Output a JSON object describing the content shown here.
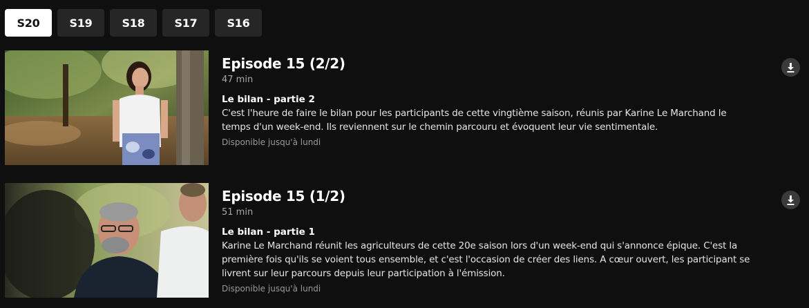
{
  "seasons": {
    "tabs": [
      {
        "label": "S20",
        "active": true
      },
      {
        "label": "S19",
        "active": false
      },
      {
        "label": "S18",
        "active": false
      },
      {
        "label": "S17",
        "active": false
      },
      {
        "label": "S16",
        "active": false
      }
    ]
  },
  "episodes": [
    {
      "title": "Episode 15 (2/2)",
      "duration": "47 min",
      "subtitle": "Le bilan - partie 2",
      "description": "C'est l'heure de faire le bilan pour les participants de cette vingtième saison, réunis par Karine Le Marchand le temps d'un week-end. Ils reviennent sur le chemin parcouru et évoquent leur vie sentimentale.",
      "availability": "Disponible jusqu'à lundi",
      "download_icon": "download-icon"
    },
    {
      "title": "Episode 15 (1/2)",
      "duration": "51 min",
      "subtitle": "Le bilan - partie 1",
      "description": "Karine Le Marchand réunit les agriculteurs de cette 20e saison lors d'un week-end qui s'annonce épique. C'est la première fois qu'ils se voient tous ensemble, et c'est l'occasion de créer des liens. A cœur ouvert, les participant se livrent sur leur parcours depuis leur participation à l'émission.",
      "availability": "Disponible jusqu'à lundi",
      "download_icon": "download-icon"
    }
  ],
  "colors": {
    "background": "#0f0f0f",
    "tab_inactive": "#262626",
    "tab_active": "#ffffff",
    "muted_text": "#a8a8a8"
  }
}
